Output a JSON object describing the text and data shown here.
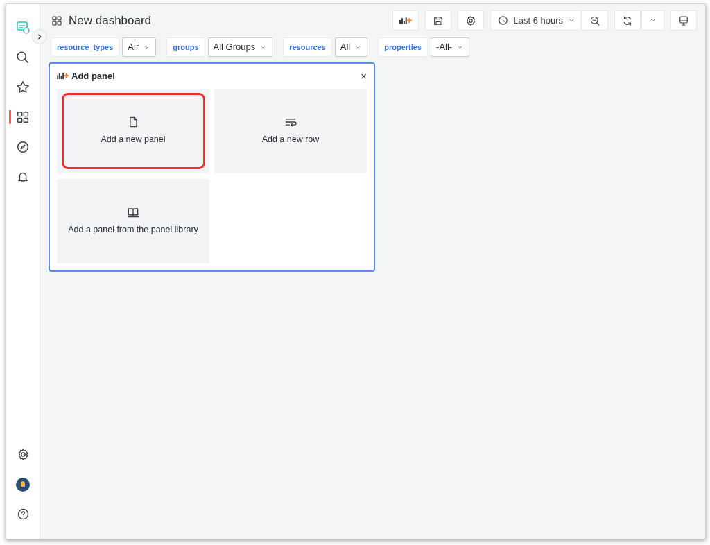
{
  "sidebar": {
    "items": [
      {
        "kind": "logo",
        "selected": false
      },
      {
        "kind": "search",
        "selected": false
      },
      {
        "kind": "star",
        "selected": false
      },
      {
        "kind": "dashboards",
        "selected": true
      },
      {
        "kind": "explore",
        "selected": false
      },
      {
        "kind": "alerts",
        "selected": false
      }
    ],
    "bottom_items": [
      {
        "kind": "settings"
      },
      {
        "kind": "avatar"
      },
      {
        "kind": "help"
      }
    ]
  },
  "header": {
    "title": "New dashboard",
    "toolbar": [
      {
        "kind": "add-panel"
      },
      {
        "kind": "save"
      },
      {
        "kind": "settings"
      },
      {
        "kind": "time-range",
        "label": "Last 6 hours"
      },
      {
        "kind": "zoom-out"
      },
      {
        "kind": "refresh"
      },
      {
        "kind": "refresh-menu"
      },
      {
        "kind": "tv-mode"
      }
    ]
  },
  "variables": [
    {
      "label": "resource_types",
      "value": "Air"
    },
    {
      "label": "groups",
      "value": "All Groups"
    },
    {
      "label": "resources",
      "value": "All"
    },
    {
      "label": "properties",
      "value": "-All-"
    }
  ],
  "add_panel": {
    "title": "Add panel",
    "close": "×",
    "options": [
      {
        "kind": "new-panel",
        "label": "Add a new panel",
        "highlighted": true
      },
      {
        "kind": "new-row",
        "label": "Add a new row",
        "highlighted": false
      },
      {
        "kind": "library",
        "label": "Add a panel from the panel library",
        "highlighted": false
      }
    ]
  }
}
